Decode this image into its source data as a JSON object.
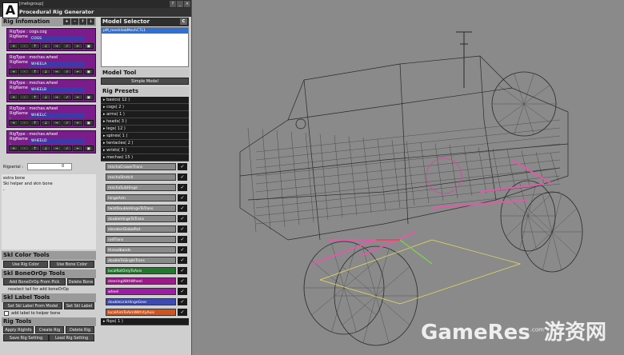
{
  "badge": "A",
  "window": {
    "title": "[melsgroup]",
    "rig_generator_title": "Procedural Rig Generator",
    "buttons": [
      "?",
      "_",
      "×"
    ]
  },
  "rig_information": {
    "header": "Rig Infomation",
    "header_buttons": [
      "+",
      "-",
      "↑",
      "↓"
    ],
    "rigname_label": "RigName :",
    "blocks": [
      {
        "type": "RigType : cogs.cog",
        "name": "COGS",
        "color": "#7a1d8a"
      },
      {
        "type": "RigType : mechas.wheel",
        "name": "WHEELA",
        "color": "#7a1d8a"
      },
      {
        "type": "RigType : mechas.wheel",
        "name": "WHEELB",
        "color": "#7a1d8a"
      },
      {
        "type": "RigType : mechas.wheel",
        "name": "WHEELC",
        "color": "#7a1d8a"
      },
      {
        "type": "RigType : mechas.wheel",
        "name": "WHEELD",
        "color": "#7a1d8a"
      }
    ],
    "block_buttons": [
      "+",
      "-",
      "↑",
      "↓",
      "→",
      "✓",
      "←",
      "▣"
    ],
    "rig_serial_label": "Rigserial :",
    "rig_serial_value": "0",
    "notes": [
      "extra bone",
      "Ski helper and skin bone",
      "-"
    ]
  },
  "skl_color_tools": {
    "header": "Skl Color Tools",
    "buttons": [
      "Use Rig Color",
      "Use Bone Color"
    ]
  },
  "skl_boneofop_tools": {
    "header": "Skl BoneOrOp Tools",
    "buttons": [
      "Add BoneOrOp From Pick",
      "Delete Bone"
    ],
    "option": "reselect tail for add boneOrOp"
  },
  "skl_label_tools": {
    "header": "Skl Label Tools",
    "buttons": [
      "Set Skl Label From Model",
      "Set Skl Label"
    ],
    "option": "add label to helper bone"
  },
  "rig_tools": {
    "header": "Rig Tools",
    "row1": [
      "Apply RigInfo",
      "Create Rig",
      "Delete Rig"
    ],
    "row2": [
      "Save Rig Setting",
      "Load Rig Setting"
    ]
  },
  "model_selector": {
    "header": "Model Selector",
    "header_button": "C",
    "selected_item": "pM_mesh4obMechCTL1"
  },
  "model_tool": {
    "header": "Model Tool",
    "button": "Simple Model"
  },
  "rig_presets": {
    "header": "Rig Presets",
    "groups": [
      {
        "label": "basics( 12 )"
      },
      {
        "label": "cogs( 2 )"
      },
      {
        "label": "arms( 1 )"
      },
      {
        "label": "heads( 3 )"
      },
      {
        "label": "legs( 12 )"
      },
      {
        "label": "spines( 1 )"
      },
      {
        "label": "tentacles( 2 )"
      },
      {
        "label": "wrists( 3 )"
      },
      {
        "label": "mechas( 15 )"
      }
    ],
    "mecha_items": [
      {
        "label": "mechaCrawerTrans",
        "color": "#8a8a8a"
      },
      {
        "label": "mechaStretch",
        "color": "#8a8a8a"
      },
      {
        "label": "mechaSubHinge",
        "color": "#8a8a8a"
      },
      {
        "label": "hingeArm",
        "color": "#8a8a8a"
      },
      {
        "label": "twistDoubleHingeToTrans",
        "color": "#8a8a8a"
      },
      {
        "label": "doubleHingeToTrans",
        "color": "#8a8a8a"
      },
      {
        "label": "elevatorGlobalRot",
        "color": "#8a8a8a"
      },
      {
        "label": "rodTrans",
        "color": "#8a8a8a"
      },
      {
        "label": "threadbands",
        "color": "#8a8a8a"
      },
      {
        "label": "doubleToSingleTrans",
        "color": "#8a8a8a"
      },
      {
        "label": "localRotOnlyToAxis",
        "color": "#1f7a2a"
      },
      {
        "label": "steeringWithWheel",
        "color": "#9a1a8a"
      },
      {
        "label": "wheel",
        "color": "#a019a8"
      },
      {
        "label": "doubleLinkHingeGear",
        "color": "#3d4bb0"
      },
      {
        "label": "localAimToAimWithXyAxis",
        "color": "#d2541c"
      }
    ],
    "mecha_check": "✓",
    "last_group": "fkps( 1 )"
  },
  "watermark": {
    "brand": "GameRes",
    "suffix": ".com",
    "cn": "游资网"
  }
}
